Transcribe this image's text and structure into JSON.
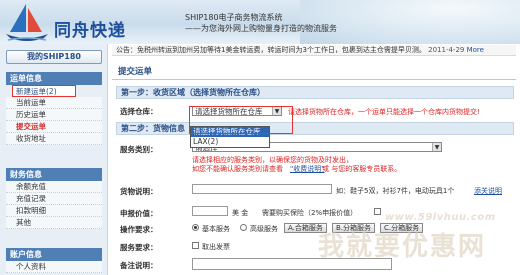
{
  "header": {
    "logo_text": "同舟快递",
    "slogan1": "SHIP180电子商务物流系统",
    "slogan2": "——为您海外网上购物量身打造的物流服务"
  },
  "sidebar": {
    "my_ship": "我的SHIP180",
    "sections": [
      {
        "title": "运单信息",
        "items": [
          "新建运单(2)",
          "当前运单",
          "历史运单",
          "提交运单",
          "收货地址"
        ]
      },
      {
        "title": "财务信息",
        "items": [
          "余额充值",
          "充值记录",
          "扣款明细",
          "其他"
        ]
      },
      {
        "title": "账户信息",
        "items": [
          "个人资料"
        ]
      }
    ]
  },
  "notice": {
    "prefix": "公告：免税州转运到加州另加等待1美金转运费，转运时间为3个工作日，包裹到达主仓需提早贝测。",
    "date": "2011-4-29",
    "more": "More"
  },
  "main": {
    "title": "提交运单",
    "step1": "第一步：收货区域（选择货物所在仓库）",
    "warehouse_label": "选择仓库：",
    "warehouse_value": "请选择货物所在仓库",
    "warehouse_note": "请选择货物所在仓库，一个运单只能选择一个仓库内货物提交!",
    "dropdown_options": [
      "请选择货物所在仓库",
      "LAX(2)"
    ],
    "step2": "第二步：货物信息",
    "service_label": "服务类别：",
    "service_value": "请选择",
    "service_note1": "请选择相应的服务类别，以确保您的货物及时发出，",
    "service_note2": "如您不能确认服务类别请查看",
    "service_link": "\"收费说明\"",
    "service_note3": "或 与您的客服专员联系。",
    "goods_label": "货物说明：",
    "goods_hint": "如：鞋子5双，衬衫7件，电动玩具1个",
    "add_link": "添关说明",
    "value_label": "申报价值：",
    "currency": "美 金",
    "insurance_label": "需要购买保险（2%申报价值）",
    "op_label": "操作要求：",
    "op_basic": "基本服务",
    "op_advanced": "高级服务",
    "op_box": "A.合箱服务",
    "op_split": "B.分箱服务",
    "op_fix": "C.分箱服务",
    "pack_label": "服务要求：",
    "pack_opt": "取出发票",
    "remark_label": "备注说明："
  },
  "watermark": {
    "url": "www.59lvhuu.com",
    "big": "我就要优惠网"
  },
  "colors": {
    "accent": "#2a4f86",
    "highlight": "#e53333",
    "sidebar_head": "#4f7fb5"
  }
}
